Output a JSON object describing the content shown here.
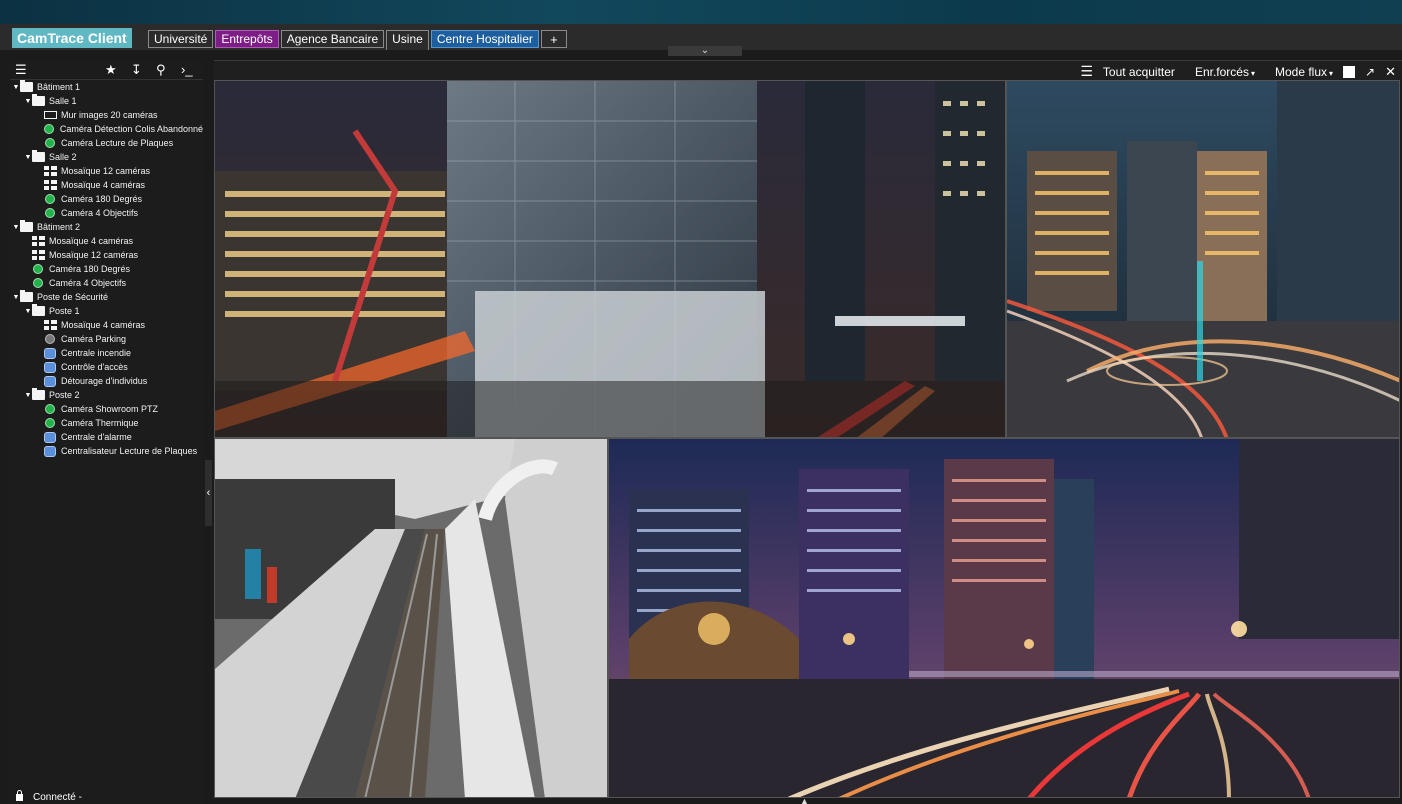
{
  "app": {
    "brand": "CamTrace Client"
  },
  "tabs": [
    {
      "label": "Université",
      "style": "plain"
    },
    {
      "label": "Entrepôts",
      "style": "purple"
    },
    {
      "label": "Agence Bancaire",
      "style": "plain"
    },
    {
      "label": "Usine",
      "style": "active"
    },
    {
      "label": "Centre Hospitalier",
      "style": "blue"
    },
    {
      "label": "+",
      "style": "add"
    }
  ],
  "sidebar": {
    "toolbar_icons": [
      "menu-icon",
      "star-icon",
      "sort-icon",
      "search-icon",
      "terminal-icon"
    ],
    "tree": [
      {
        "label": "Bâtiment 1",
        "level": 0,
        "type": "folder",
        "caret": true
      },
      {
        "label": "Salle 1",
        "level": 1,
        "type": "folder",
        "caret": true
      },
      {
        "label": "Mur images 20 caméras",
        "level": 2,
        "type": "monitor"
      },
      {
        "label": "Caméra Détection Colis Abandonné",
        "level": 2,
        "type": "camera"
      },
      {
        "label": "Caméra Lecture de Plaques",
        "level": 2,
        "type": "camera"
      },
      {
        "label": "Salle 2",
        "level": 1,
        "type": "folder",
        "caret": true
      },
      {
        "label": "Mosaïque 12 caméras",
        "level": 2,
        "type": "mosaic"
      },
      {
        "label": "Mosaïque 4 caméras",
        "level": 2,
        "type": "mosaic"
      },
      {
        "label": "Caméra 180 Degrés",
        "level": 2,
        "type": "camera"
      },
      {
        "label": "Caméra 4 Objectifs",
        "level": 2,
        "type": "camera"
      },
      {
        "label": "Bâtiment 2",
        "level": 0,
        "type": "folder",
        "caret": true
      },
      {
        "label": "Mosaïque 4 caméras",
        "level": 1,
        "type": "mosaic"
      },
      {
        "label": "Mosaïque 12 caméras",
        "level": 1,
        "type": "mosaic"
      },
      {
        "label": "Caméra 180 Degrés",
        "level": 1,
        "type": "camera"
      },
      {
        "label": "Caméra 4 Objectifs",
        "level": 1,
        "type": "camera"
      },
      {
        "label": "Poste de Sécurité",
        "level": 0,
        "type": "folder",
        "caret": true
      },
      {
        "label": "Poste 1",
        "level": 1,
        "type": "folder",
        "caret": true
      },
      {
        "label": "Mosaïque 4 caméras",
        "level": 2,
        "type": "mosaic"
      },
      {
        "label": "Caméra Parking",
        "level": 2,
        "type": "camera-grey"
      },
      {
        "label": "Centrale incendie",
        "level": 2,
        "type": "alarm"
      },
      {
        "label": "Contrôle d'accès",
        "level": 2,
        "type": "alarm"
      },
      {
        "label": "Détourage d'individus",
        "level": 2,
        "type": "alarm"
      },
      {
        "label": "Poste 2",
        "level": 1,
        "type": "folder",
        "caret": true
      },
      {
        "label": "Caméra Showroom PTZ",
        "level": 2,
        "type": "camera"
      },
      {
        "label": "Caméra Thermique",
        "level": 2,
        "type": "camera"
      },
      {
        "label": "Centrale d'alarme",
        "level": 2,
        "type": "alarm"
      },
      {
        "label": "Centralisateur Lecture de Plaques",
        "level": 2,
        "type": "alarm"
      }
    ],
    "status": "Connecté -"
  },
  "viewbar": {
    "acknowledge_all": "Tout acquitter",
    "forced_recording": "Enr.forcés",
    "stream_mode": "Mode flux"
  },
  "colors": {
    "brand": "#5fb8c4",
    "tab_purple": "#7d1d86",
    "tab_blue": "#1d5f9e",
    "camera_ok": "#24b24a",
    "alarm": "#5b8fd9"
  }
}
